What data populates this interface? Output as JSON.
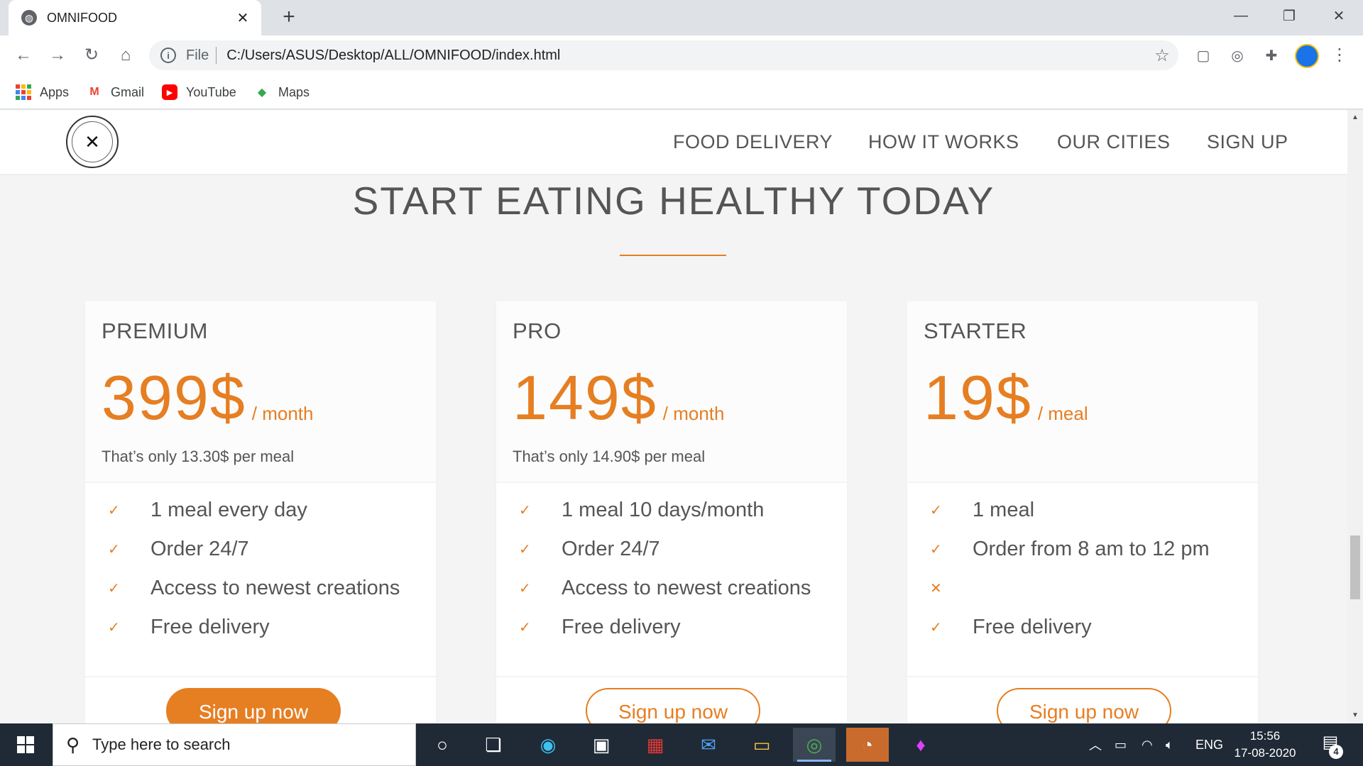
{
  "browser": {
    "tab_title": "OMNIFOOD",
    "tab_close": "✕",
    "new_tab": "+",
    "url_scheme": "File",
    "url": "C:/Users/ASUS/Desktop/ALL/OMNIFOOD/index.html",
    "bookmarks": [
      {
        "label": "Apps"
      },
      {
        "label": "Gmail"
      },
      {
        "label": "YouTube"
      },
      {
        "label": "Maps"
      }
    ]
  },
  "site": {
    "nav": [
      "FOOD DELIVERY",
      "HOW IT WORKS",
      "OUR CITIES",
      "SIGN UP"
    ],
    "section_title": "START EATING HEALTHY TODAY",
    "plans": [
      {
        "name": "PREMIUM",
        "price": "399$",
        "unit": "/ month",
        "note": "That’s only 13.30$ per meal",
        "features": [
          {
            "mark": "✓",
            "text": "1 meal every day"
          },
          {
            "mark": "✓",
            "text": "Order 24/7"
          },
          {
            "mark": "✓",
            "text": "Access to newest creations"
          },
          {
            "mark": "✓",
            "text": "Free delivery"
          }
        ],
        "button": "Sign up now",
        "button_style": "full"
      },
      {
        "name": "PRO",
        "price": "149$",
        "unit": "/ month",
        "note": "That’s only 14.90$ per meal",
        "features": [
          {
            "mark": "✓",
            "text": "1 meal 10 days/month"
          },
          {
            "mark": "✓",
            "text": "Order 24/7"
          },
          {
            "mark": "✓",
            "text": "Access to newest creations"
          },
          {
            "mark": "✓",
            "text": "Free delivery"
          }
        ],
        "button": "Sign up now",
        "button_style": "ghost"
      },
      {
        "name": "STARTER",
        "price": "19$",
        "unit": "/ meal",
        "note": "",
        "features": [
          {
            "mark": "✓",
            "text": "1 meal"
          },
          {
            "mark": "✓",
            "text": "Order from 8 am to 12 pm"
          },
          {
            "mark": "✕",
            "text": ""
          },
          {
            "mark": "✓",
            "text": "Free delivery"
          }
        ],
        "button": "Sign up now",
        "button_style": "ghost"
      }
    ]
  },
  "taskbar": {
    "search_placeholder": "Type here to search",
    "language": "ENG",
    "time": "15:56",
    "date": "17-08-2020",
    "notification_count": "4"
  },
  "colors": {
    "accent": "#e67e22",
    "page_bg": "#f4f4f4",
    "text": "#555555",
    "taskbar": "#1f2a36"
  }
}
